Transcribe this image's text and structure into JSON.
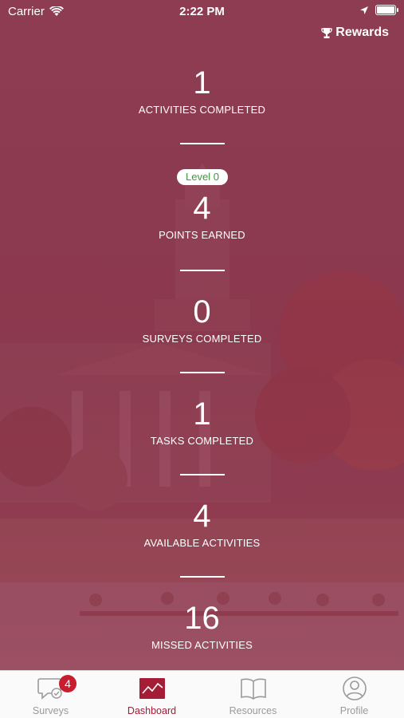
{
  "status_bar": {
    "carrier": "Carrier",
    "time": "2:22 PM"
  },
  "header": {
    "rewards_label": "Rewards"
  },
  "level_badge": "Level 0",
  "stats": [
    {
      "value": "1",
      "label": "ACTIVITIES COMPLETED"
    },
    {
      "value": "4",
      "label": "POINTS EARNED"
    },
    {
      "value": "0",
      "label": "SURVEYS COMPLETED"
    },
    {
      "value": "1",
      "label": "TASKS COMPLETED"
    },
    {
      "value": "4",
      "label": "AVAILABLE ACTIVITIES"
    },
    {
      "value": "16",
      "label": "MISSED ACTIVITIES"
    }
  ],
  "tabbar": {
    "tabs": [
      {
        "label": "Surveys",
        "badge": "4"
      },
      {
        "label": "Dashboard"
      },
      {
        "label": "Resources"
      },
      {
        "label": "Profile"
      }
    ],
    "active": "Dashboard"
  },
  "colors": {
    "accent": "#a51c36",
    "overlay": "#8b3a4e",
    "level_text": "#3a9a3a",
    "badge": "#c81d2f"
  }
}
